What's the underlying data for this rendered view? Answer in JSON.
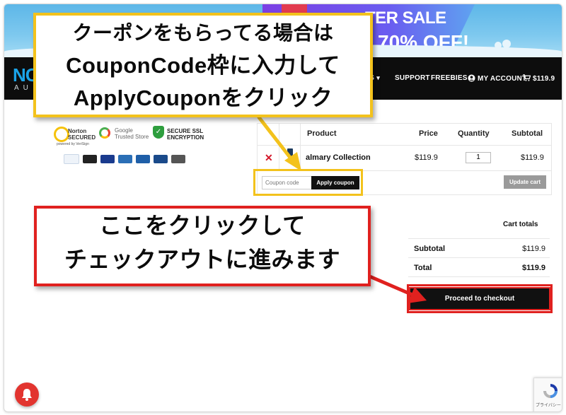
{
  "promo": {
    "sale_title": "TER SALE",
    "sale_discount": "70% OFF!"
  },
  "nav": {
    "logo_text": "NC",
    "logo_sub": "AU",
    "items": [
      {
        "label": "TS",
        "has_chevron": true
      },
      {
        "label": "SUPPORT"
      },
      {
        "label": "FREEBIES"
      },
      {
        "label": "MY ACCOUNT"
      },
      {
        "label": "$119.9"
      }
    ]
  },
  "badges": {
    "norton": "Norton SECURED",
    "norton_sub": "powered by VeriSign",
    "google": "Google Trusted Store",
    "secure": "SECURE SSL ENCRYPTION"
  },
  "cart": {
    "headers": {
      "product": "Product",
      "price": "Price",
      "quantity": "Quantity",
      "subtotal": "Subtotal"
    },
    "items": [
      {
        "name": "almary Collection",
        "price": "$119.9",
        "quantity": "1",
        "subtotal": "$119.9"
      }
    ],
    "coupon_placeholder": "Coupon code",
    "apply_coupon_label": "Apply coupon",
    "update_cart_label": "Update cart"
  },
  "totals": {
    "title": "Cart totals",
    "subtotal_label": "Subtotal",
    "subtotal_value": "$119.9",
    "total_label": "Total",
    "total_value": "$119.9",
    "checkout_label": "Proceed to checkout"
  },
  "annotations": {
    "coupon_note": [
      "クーポンをもらってる場合は",
      "CouponCode枠に入力して",
      "ApplyCouponをクリック"
    ],
    "checkout_note": [
      "ここをクリックして",
      "チェックアウトに進みます"
    ]
  },
  "recaptcha": {
    "footer": "プライバシー・利用規約"
  },
  "colors": {
    "annotation_yellow": "#f3c21c",
    "annotation_red": "#e0211f",
    "remove_red": "#d4182a",
    "nav_bg": "#0d0d0d"
  },
  "icons": [
    "user-icon",
    "cart-icon",
    "close-icon",
    "bell-icon",
    "recaptcha-icon",
    "chevron-down-icon"
  ]
}
